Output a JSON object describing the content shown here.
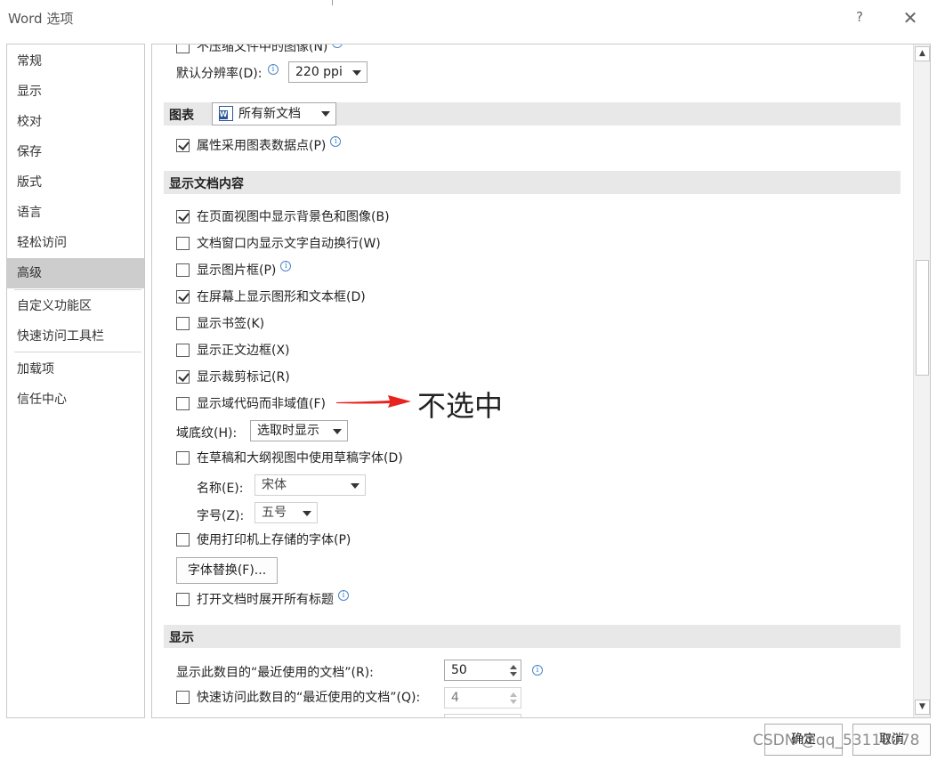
{
  "window": {
    "title": "Word 选项",
    "help": "?",
    "close": "✕"
  },
  "nav": {
    "items": [
      "常规",
      "显示",
      "校对",
      "保存",
      "版式",
      "语言",
      "轻松访问",
      "高级",
      "自定义功能区",
      "快速访问工具栏",
      "加载项",
      "信任中心"
    ],
    "active": "高级"
  },
  "top": {
    "cutoff_label": "不压缩文件中的图像(N)",
    "resolution_label": "默认分辨率(D):",
    "resolution_value": "220 ppi"
  },
  "chart_section": {
    "title": "图表",
    "doc_select": "所有新文档",
    "property_label": "属性采用图表数据点(P)",
    "property_checked": true
  },
  "display_content": {
    "title": "显示文档内容",
    "options": [
      {
        "label": "在页面视图中显示背景色和图像(B)",
        "checked": true
      },
      {
        "label": "文档窗口内显示文字自动换行(W)",
        "checked": false
      },
      {
        "label": "显示图片框(P)",
        "checked": false
      },
      {
        "label": "在屏幕上显示图形和文本框(D)",
        "checked": true
      },
      {
        "label": "显示书签(K)",
        "checked": false
      },
      {
        "label": "显示正文边框(X)",
        "checked": false
      },
      {
        "label": "显示裁剪标记(R)",
        "checked": true
      },
      {
        "label": "显示域代码而非域值(F)",
        "checked": false
      }
    ],
    "shading_label": "域底纹(H):",
    "shading_value": "选取时显示",
    "draft_font_label": "在草稿和大纲视图中使用草稿字体(D)",
    "draft_font_checked": false,
    "font_name_label": "名称(E):",
    "font_name_value": "宋体",
    "font_size_label": "字号(Z):",
    "font_size_value": "五号",
    "printer_fonts_label": "使用打印机上存储的字体(P)",
    "printer_fonts_checked": false,
    "font_sub_button": "字体替换(F)...",
    "expand_headings_label": "打开文档时展开所有标题",
    "expand_headings_checked": false
  },
  "display": {
    "title": "显示",
    "recent_docs_label": "显示此数目的“最近使用的文档”(R):",
    "recent_docs_value": "50",
    "quick_access_label": "快速访问此数目的“最近使用的文档”(Q):",
    "quick_access_value": "4",
    "quick_access_checked": false
  },
  "annotation": {
    "text": "不选中",
    "color": "#e8231f"
  },
  "footer": {
    "ok": "确定",
    "cancel": "取消",
    "watermark": "CSDN @qq_53118078"
  }
}
